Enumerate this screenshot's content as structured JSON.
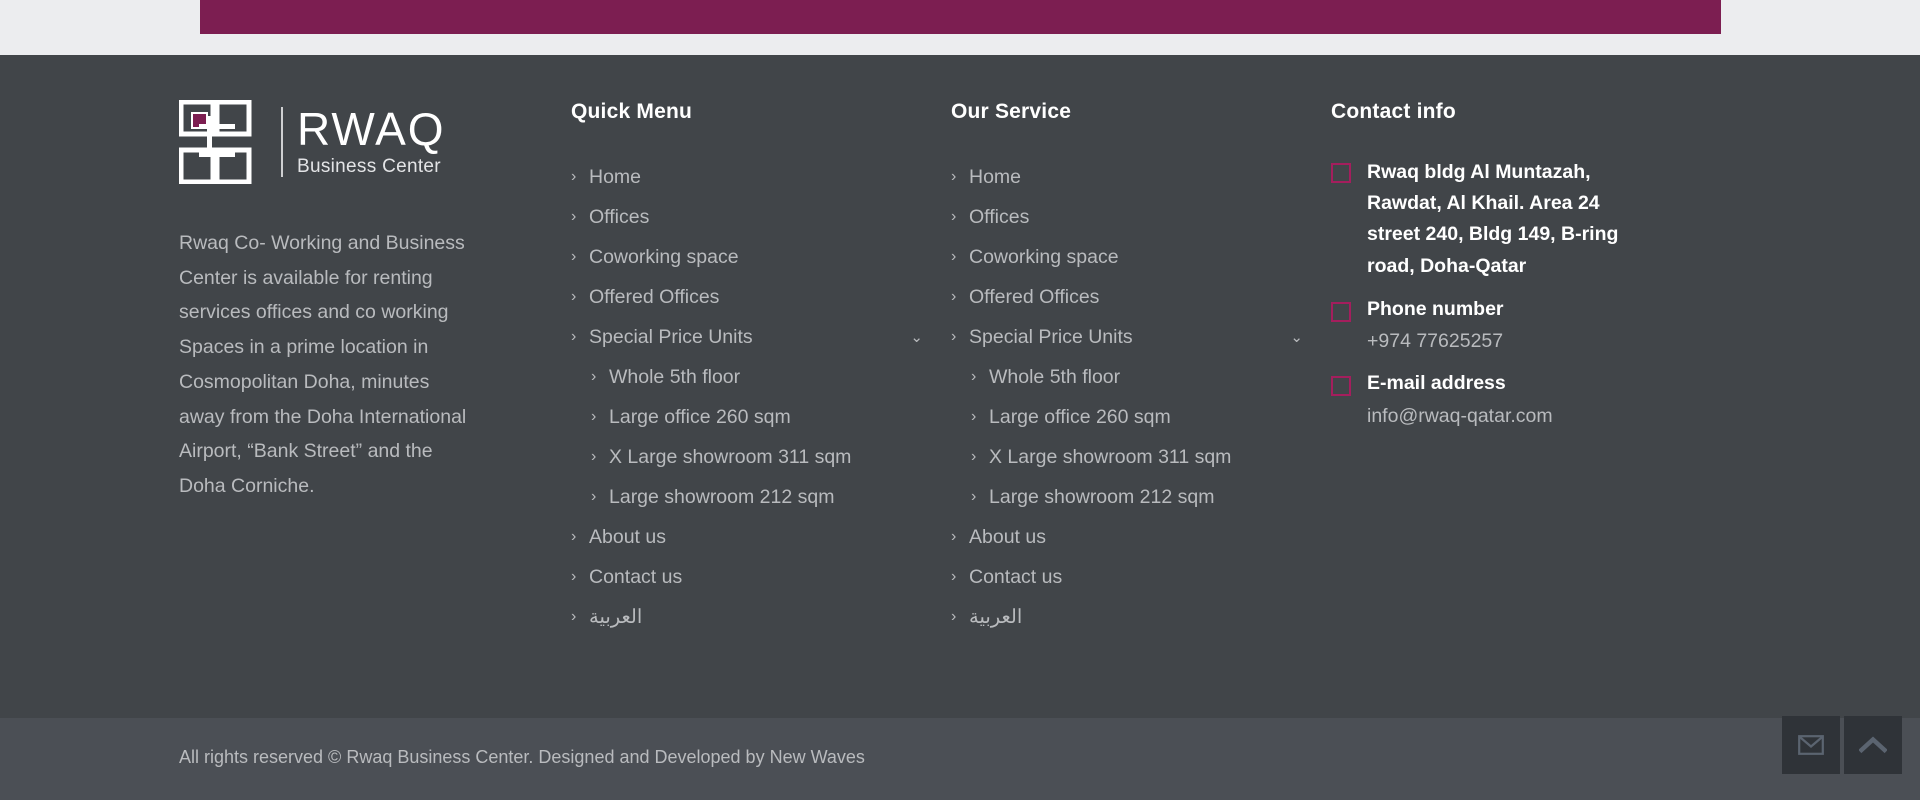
{
  "colors": {
    "accent_magenta": "#7c1e51",
    "icon_magenta": "#a41e5d",
    "footer_bg": "#414549",
    "footer_bottom_bg": "#4b4f55",
    "page_bg": "#ecedef",
    "text_muted": "#b9bbbe",
    "text_white": "#ffffff"
  },
  "brand": {
    "logo_main": "RWAQ",
    "logo_sub": "Business Center",
    "description": "Rwaq Co- Working and Business Center is available for renting services offices and co working Spaces in a prime location in Cosmopolitan Doha, minutes away from the Doha International Airport, “Bank Street” and the Doha Corniche."
  },
  "quick_menu": {
    "title": "Quick Menu",
    "items": [
      {
        "label": "Home",
        "sub": false,
        "expandable": false
      },
      {
        "label": "Offices",
        "sub": false,
        "expandable": false
      },
      {
        "label": "Coworking space",
        "sub": false,
        "expandable": false
      },
      {
        "label": "Offered Offices",
        "sub": false,
        "expandable": false
      },
      {
        "label": "Special Price Units",
        "sub": false,
        "expandable": true
      },
      {
        "label": "Whole 5th floor",
        "sub": true,
        "expandable": false
      },
      {
        "label": "Large office 260 sqm",
        "sub": true,
        "expandable": false
      },
      {
        "label": "X Large showroom 311 sqm",
        "sub": true,
        "expandable": false
      },
      {
        "label": "Large showroom 212 sqm",
        "sub": true,
        "expandable": false
      },
      {
        "label": "About us",
        "sub": false,
        "expandable": false
      },
      {
        "label": "Contact us",
        "sub": false,
        "expandable": false
      },
      {
        "label": "العربية",
        "sub": false,
        "expandable": false
      }
    ]
  },
  "our_service": {
    "title": "Our Service",
    "items": [
      {
        "label": "Home",
        "sub": false,
        "expandable": false
      },
      {
        "label": "Offices",
        "sub": false,
        "expandable": false
      },
      {
        "label": "Coworking space",
        "sub": false,
        "expandable": false
      },
      {
        "label": "Offered Offices",
        "sub": false,
        "expandable": false
      },
      {
        "label": "Special Price Units",
        "sub": false,
        "expandable": true
      },
      {
        "label": "Whole 5th floor",
        "sub": true,
        "expandable": false
      },
      {
        "label": "Large office 260 sqm",
        "sub": true,
        "expandable": false
      },
      {
        "label": "X Large showroom 311 sqm",
        "sub": true,
        "expandable": false
      },
      {
        "label": "Large showroom 212 sqm",
        "sub": true,
        "expandable": false
      },
      {
        "label": "About us",
        "sub": false,
        "expandable": false
      },
      {
        "label": "Contact us",
        "sub": false,
        "expandable": false
      },
      {
        "label": "العربية",
        "sub": false,
        "expandable": false
      }
    ]
  },
  "contact": {
    "title": "Contact info",
    "address": "Rwaq bldg Al Muntazah, Rawdat, Al Khail. Area 24 street 240, Bldg 149, B-ring road, Doha-Qatar",
    "phone_label": "Phone number",
    "phone_value": "+974 77625257",
    "email_label": "E-mail address",
    "email_value": "info@rwaq-qatar.com",
    "address_icon": "map-marker-icon",
    "phone_icon": "phone-icon",
    "email_icon": "envelope-icon"
  },
  "bottom": {
    "copyright": "All rights reserved © Rwaq Business Center. Designed and Developed by New Waves"
  },
  "fabs": [
    {
      "name": "contact-email-button",
      "icon": "envelope-icon"
    },
    {
      "name": "scroll-to-top-button",
      "icon": "chevron-up-icon"
    }
  ],
  "icons": {
    "chevron_right": "›",
    "chevron_down": "⌄"
  }
}
